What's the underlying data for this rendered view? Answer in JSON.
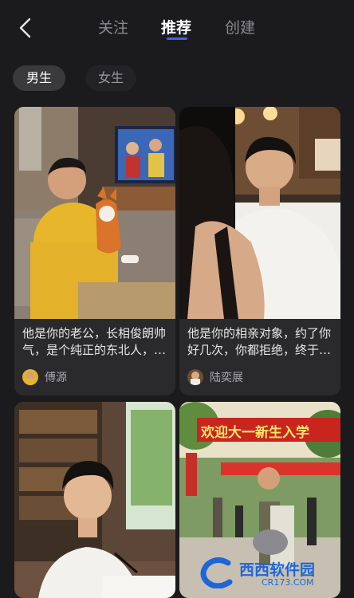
{
  "tabs": [
    {
      "label": "关注"
    },
    {
      "label": "推荐"
    },
    {
      "label": "创建"
    }
  ],
  "filters": [
    {
      "label": "男生"
    },
    {
      "label": "女生"
    }
  ],
  "cards": [
    {
      "description": "他是你的老公，长相俊朗帅气，是个纯正的东北人，性格直爽",
      "author": "傅源"
    },
    {
      "description": "他是你的相亲对象，约了你好几次，你都拒绝，终于答应见面",
      "author": "陆奕展"
    },
    {
      "description": "",
      "author": ""
    },
    {
      "description": "",
      "author": "",
      "banner_text": "欢迎大一新生入学"
    }
  ],
  "watermark": {
    "name": "西西软件园",
    "domain": "CR173.COM"
  },
  "colors": {
    "accent": "#3c63f5",
    "background": "#1b1b1d",
    "card": "#2a2a2d"
  }
}
